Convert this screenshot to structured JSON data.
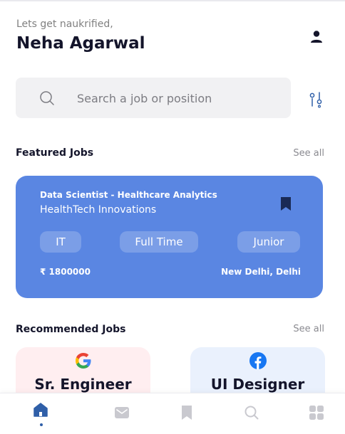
{
  "header": {
    "greeting": "Lets get naukrified,",
    "user_name": "Neha Agarwal"
  },
  "search": {
    "placeholder": "Search a job or position",
    "value": ""
  },
  "featured": {
    "section_title": "Featured Jobs",
    "see_all": "See all",
    "job": {
      "title": "Data Scientist - Healthcare Analytics",
      "company": "HealthTech Innovations",
      "tags": [
        "IT",
        "Full Time",
        "Junior"
      ],
      "salary": "₹ 1800000",
      "location": "New Delhi, Delhi"
    }
  },
  "recommended": {
    "section_title": "Recommended Jobs",
    "see_all": "See all",
    "jobs": [
      {
        "role": "Sr. Engineer",
        "logo": "google-logo",
        "bg": "#ffeef0"
      },
      {
        "role": "UI Designer",
        "logo": "facebook-logo",
        "bg": "#eaf1fd"
      }
    ]
  },
  "bottom_nav": {
    "items": [
      "home-icon",
      "mail-icon",
      "bookmark-icon",
      "search-icon",
      "grid-icon"
    ],
    "active": "home-icon"
  },
  "colors": {
    "accent": "#5a86e2",
    "nav_active": "#2f5fa8",
    "nav_inactive": "#c9c9cf",
    "text_dark": "#14152b"
  }
}
